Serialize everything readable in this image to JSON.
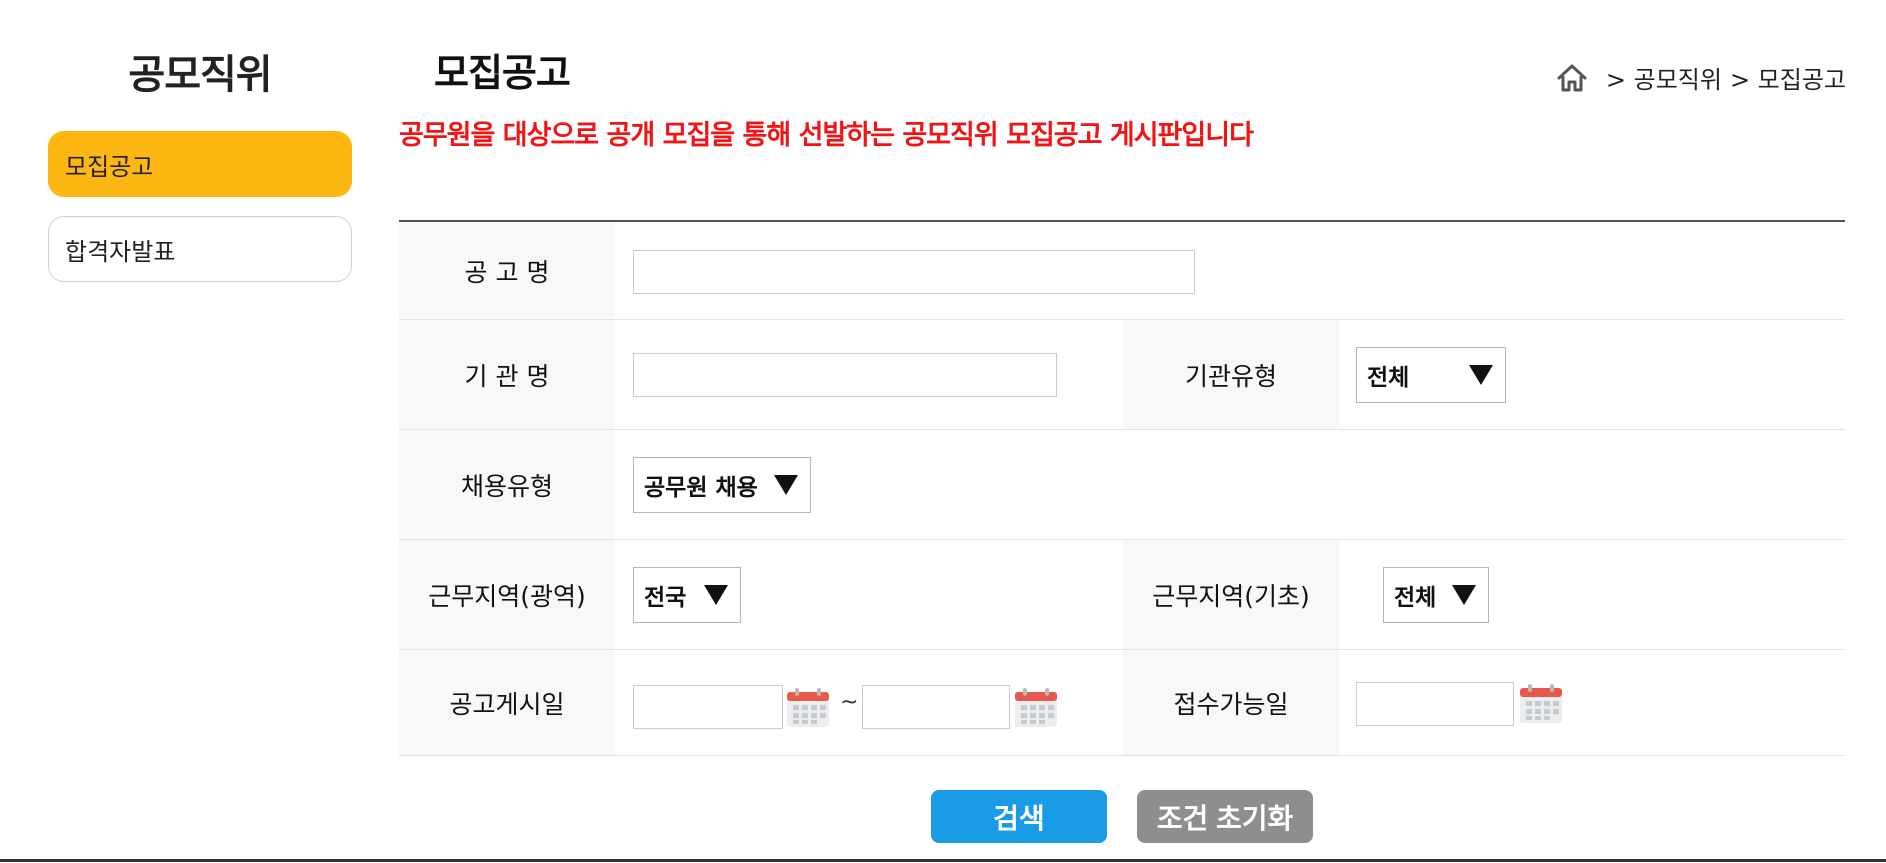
{
  "sidebar": {
    "title": "공모직위",
    "items": [
      {
        "label": "모집공고",
        "active": true
      },
      {
        "label": "합격자발표",
        "active": false
      }
    ]
  },
  "header": {
    "title": "모집공고",
    "breadcrumb": [
      "> 공모직위",
      "> 모집공고"
    ],
    "notice": "공무원을 대상으로 공개 모집을 통해 선발하는 공모직위 모집공고 게시판입니다"
  },
  "form": {
    "notice_name": {
      "label": "공 고 명",
      "value": ""
    },
    "org_name": {
      "label": "기 관 명",
      "value": ""
    },
    "org_type": {
      "label": "기관유형",
      "selected": "전체"
    },
    "hire_type": {
      "label": "채용유형",
      "selected": "공무원 채용"
    },
    "region_wide": {
      "label": "근무지역(광역)",
      "selected": "전국"
    },
    "region_local": {
      "label": "근무지역(기초)",
      "selected": "전체"
    },
    "post_date": {
      "label": "공고게시일",
      "from": "",
      "to": "",
      "separator": "~"
    },
    "accept_date": {
      "label": "접수가능일",
      "value": ""
    }
  },
  "buttons": {
    "search": "검색",
    "reset": "조건 초기화"
  },
  "colors": {
    "accent": "#fdb712",
    "notice": "#f01414",
    "search_button": "#1a9be6",
    "reset_button": "#8e8e8e"
  }
}
